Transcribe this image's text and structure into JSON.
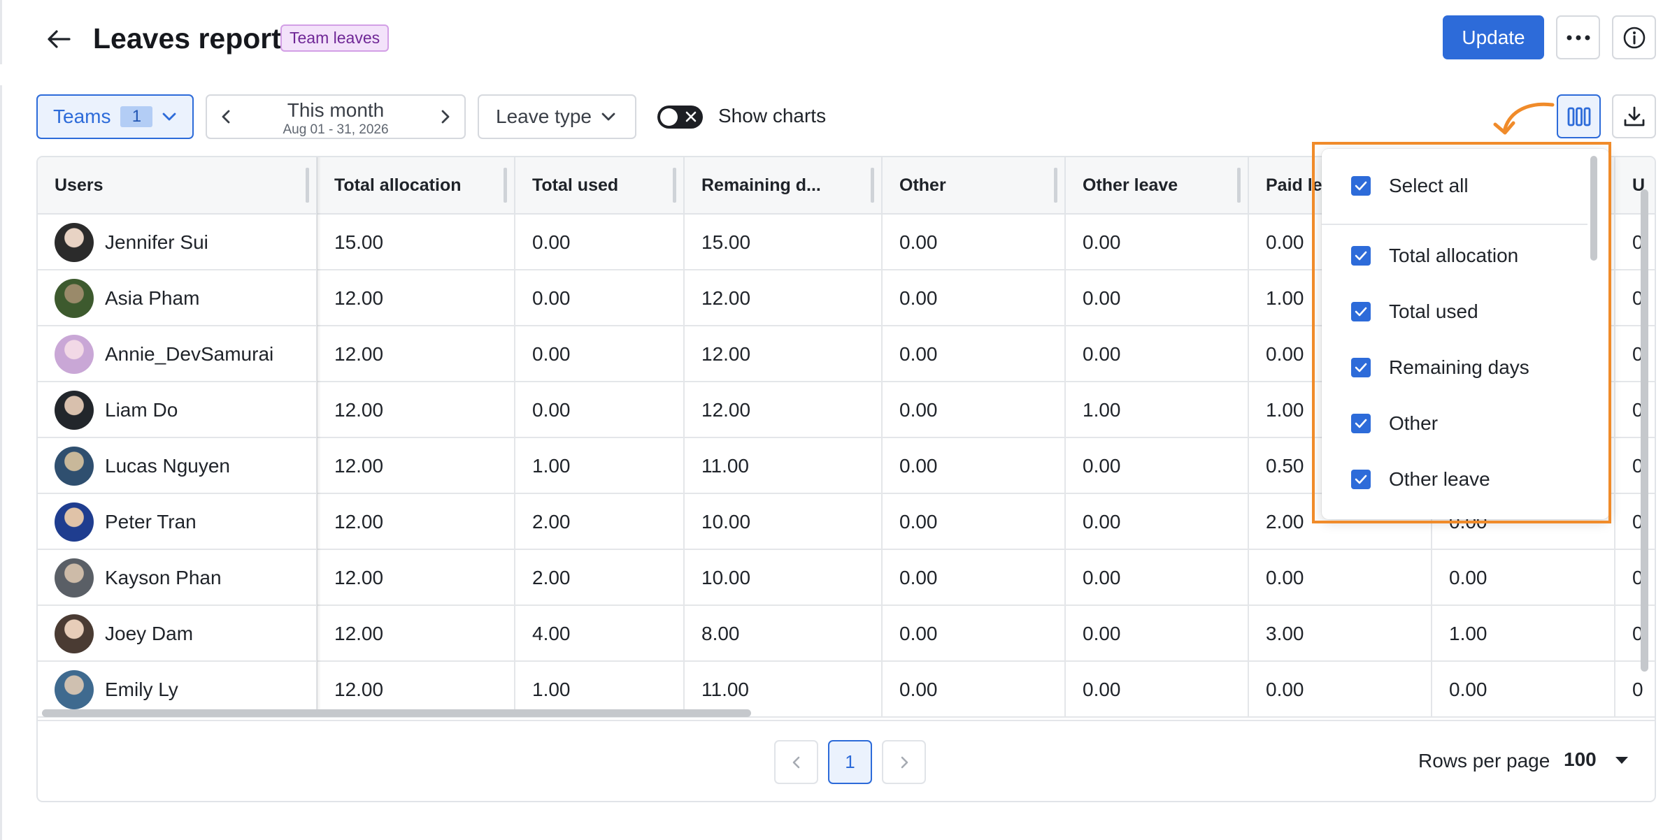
{
  "header": {
    "title": "Leaves report",
    "badge": "Team leaves",
    "update_label": "Update"
  },
  "toolbar": {
    "teams_label": "Teams",
    "teams_count": "1",
    "date_main": "This month",
    "date_sub": "Aug 01 - 31, 2026",
    "leave_type_label": "Leave type",
    "show_charts_label": "Show charts",
    "show_charts_on": false
  },
  "table": {
    "columns": [
      "Users",
      "Total allocation",
      "Total used",
      "Remaining d...",
      "Other",
      "Other leave",
      "Paid le",
      "",
      "U"
    ],
    "rows": [
      {
        "name": "Jennifer Sui",
        "cells": [
          "15.00",
          "0.00",
          "15.00",
          "0.00",
          "0.00",
          "0.00",
          "",
          "0"
        ]
      },
      {
        "name": "Asia Pham",
        "cells": [
          "12.00",
          "0.00",
          "12.00",
          "0.00",
          "0.00",
          "1.00",
          "",
          "0"
        ]
      },
      {
        "name": "Annie_DevSamurai",
        "cells": [
          "12.00",
          "0.00",
          "12.00",
          "0.00",
          "0.00",
          "0.00",
          "",
          "0"
        ]
      },
      {
        "name": "Liam Do",
        "cells": [
          "12.00",
          "0.00",
          "12.00",
          "0.00",
          "1.00",
          "1.00",
          "",
          "0"
        ]
      },
      {
        "name": "Lucas Nguyen",
        "cells": [
          "12.00",
          "1.00",
          "11.00",
          "0.00",
          "0.00",
          "0.50",
          "",
          "0"
        ]
      },
      {
        "name": "Peter Tran",
        "cells": [
          "12.00",
          "2.00",
          "10.00",
          "0.00",
          "0.00",
          "2.00",
          "0.00",
          "0"
        ]
      },
      {
        "name": "Kayson Phan",
        "cells": [
          "12.00",
          "2.00",
          "10.00",
          "0.00",
          "0.00",
          "0.00",
          "0.00",
          "0"
        ]
      },
      {
        "name": "Joey Dam",
        "cells": [
          "12.00",
          "4.00",
          "8.00",
          "0.00",
          "0.00",
          "3.00",
          "1.00",
          "0"
        ]
      },
      {
        "name": "Emily Ly",
        "cells": [
          "12.00",
          "1.00",
          "11.00",
          "0.00",
          "0.00",
          "0.00",
          "0.00",
          "0"
        ]
      }
    ]
  },
  "pagination": {
    "current_page": "1",
    "rows_per_page_label": "Rows per page",
    "rows_per_page_value": "100"
  },
  "column_menu": {
    "select_all_label": "Select all",
    "items": [
      "Total allocation",
      "Total used",
      "Remaining days",
      "Other",
      "Other leave"
    ]
  },
  "colors": {
    "accent": "#2d6bd9",
    "badge_bg": "#f3e2fa",
    "highlight": "#f08b2a"
  }
}
